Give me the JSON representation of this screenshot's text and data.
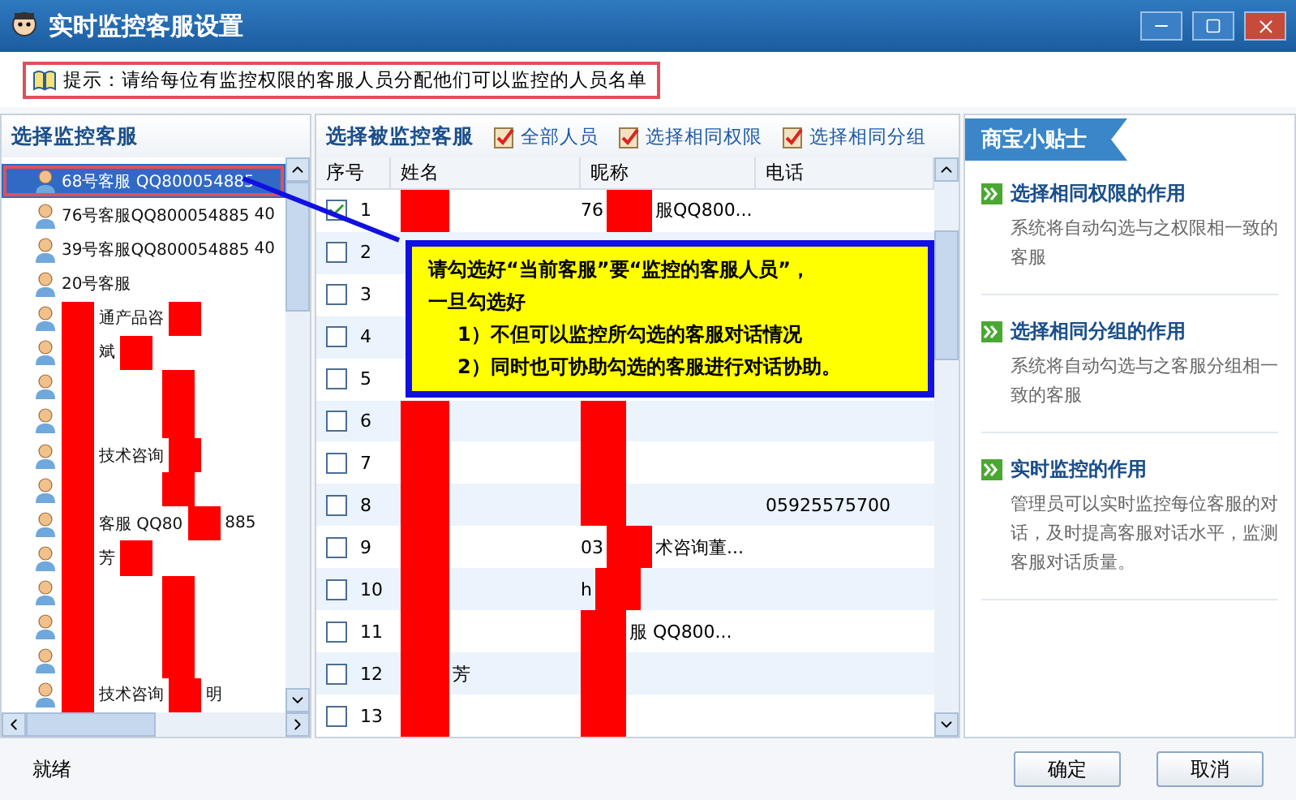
{
  "window": {
    "title": "实时监控客服设置"
  },
  "hint": "提示：请给每位有监控权限的客服人员分配他们可以监控的人员名单",
  "left_panel": {
    "title": "选择监控客服",
    "items": [
      {
        "selected": true,
        "segments": [
          {
            "kind": "text",
            "text": "68号客服 QQ800054885"
          }
        ]
      },
      {
        "selected": false,
        "segments": [
          {
            "kind": "text",
            "text": "76号客服QQ800054885"
          },
          {
            "kind": "text",
            "text": "40"
          }
        ]
      },
      {
        "selected": false,
        "segments": [
          {
            "kind": "text",
            "text": "39号客服QQ800054885"
          },
          {
            "kind": "text",
            "text": "40"
          }
        ]
      },
      {
        "selected": false,
        "segments": [
          {
            "kind": "text",
            "text": "20号客服"
          }
        ]
      },
      {
        "selected": false,
        "segments": [
          {
            "kind": "redaction"
          },
          {
            "kind": "text",
            "text": "通产品咨"
          },
          {
            "kind": "redaction"
          }
        ]
      },
      {
        "selected": false,
        "segments": [
          {
            "kind": "redaction"
          },
          {
            "kind": "text",
            "text": "斌"
          },
          {
            "kind": "redaction"
          }
        ]
      },
      {
        "selected": false,
        "segments": [
          {
            "kind": "redaction"
          },
          {
            "kind": "gap"
          },
          {
            "kind": "redaction"
          }
        ]
      },
      {
        "selected": false,
        "segments": [
          {
            "kind": "redaction"
          },
          {
            "kind": "gap"
          },
          {
            "kind": "redaction"
          }
        ]
      },
      {
        "selected": false,
        "segments": [
          {
            "kind": "redaction"
          },
          {
            "kind": "text",
            "text": "技术咨询"
          },
          {
            "kind": "redaction"
          }
        ]
      },
      {
        "selected": false,
        "segments": [
          {
            "kind": "redaction"
          },
          {
            "kind": "gap"
          },
          {
            "kind": "redaction"
          }
        ]
      },
      {
        "selected": false,
        "segments": [
          {
            "kind": "redaction"
          },
          {
            "kind": "text",
            "text": "客服 QQ80"
          },
          {
            "kind": "redaction"
          },
          {
            "kind": "text",
            "text": "885"
          }
        ]
      },
      {
        "selected": false,
        "segments": [
          {
            "kind": "redaction"
          },
          {
            "kind": "text",
            "text": "芳"
          },
          {
            "kind": "redaction"
          }
        ]
      },
      {
        "selected": false,
        "segments": [
          {
            "kind": "redaction"
          },
          {
            "kind": "gap"
          },
          {
            "kind": "redaction"
          }
        ]
      },
      {
        "selected": false,
        "segments": [
          {
            "kind": "redaction"
          },
          {
            "kind": "gap"
          },
          {
            "kind": "redaction"
          }
        ]
      },
      {
        "selected": false,
        "segments": [
          {
            "kind": "redaction"
          },
          {
            "kind": "gap"
          },
          {
            "kind": "redaction"
          }
        ]
      },
      {
        "selected": false,
        "segments": [
          {
            "kind": "redaction"
          },
          {
            "kind": "text",
            "text": "技术咨询"
          },
          {
            "kind": "redaction"
          },
          {
            "kind": "text",
            "text": "明"
          }
        ]
      }
    ]
  },
  "middle_panel": {
    "title": "选择被监控客服",
    "actions": [
      "全部人员",
      "选择相同权限",
      "选择相同分组"
    ],
    "columns": [
      "序号",
      "姓名",
      "昵称",
      "电话"
    ],
    "rows": [
      {
        "checked": true,
        "number": "1",
        "name": [
          {
            "kind": "redaction"
          }
        ],
        "nickname": [
          {
            "kind": "text",
            "text": "76"
          },
          {
            "kind": "redaction"
          },
          {
            "kind": "text",
            "text": "服QQ800..."
          }
        ],
        "phone": ""
      },
      {
        "checked": false,
        "number": "2",
        "name": [],
        "nickname": [],
        "phone": ""
      },
      {
        "checked": false,
        "number": "3",
        "name": [],
        "nickname": [],
        "phone": ""
      },
      {
        "checked": false,
        "number": "4",
        "name": [],
        "nickname": [],
        "phone": ""
      },
      {
        "checked": false,
        "number": "5",
        "name": [],
        "nickname": [],
        "phone": ""
      },
      {
        "checked": false,
        "number": "6",
        "name": [
          {
            "kind": "redaction"
          }
        ],
        "nickname": [
          {
            "kind": "redaction"
          }
        ],
        "phone": ""
      },
      {
        "checked": false,
        "number": "7",
        "name": [
          {
            "kind": "redaction"
          }
        ],
        "nickname": [
          {
            "kind": "redaction"
          }
        ],
        "phone": ""
      },
      {
        "checked": false,
        "number": "8",
        "name": [
          {
            "kind": "redaction"
          }
        ],
        "nickname": [
          {
            "kind": "redaction"
          }
        ],
        "phone": "05925575700"
      },
      {
        "checked": false,
        "number": "9",
        "name": [
          {
            "kind": "redaction"
          }
        ],
        "nickname": [
          {
            "kind": "text",
            "text": "03"
          },
          {
            "kind": "redaction"
          },
          {
            "kind": "text",
            "text": "术咨询董..."
          }
        ],
        "phone": ""
      },
      {
        "checked": false,
        "number": "10",
        "name": [
          {
            "kind": "redaction"
          }
        ],
        "nickname": [
          {
            "kind": "text",
            "text": "h"
          },
          {
            "kind": "redaction"
          }
        ],
        "phone": ""
      },
      {
        "checked": false,
        "number": "11",
        "name": [
          {
            "kind": "redaction"
          }
        ],
        "nickname": [
          {
            "kind": "redaction"
          },
          {
            "kind": "text",
            "text": "服 QQ800..."
          }
        ],
        "phone": ""
      },
      {
        "checked": false,
        "number": "12",
        "name": [
          {
            "kind": "redaction"
          },
          {
            "kind": "text",
            "text": "芳"
          }
        ],
        "nickname": [
          {
            "kind": "redaction"
          }
        ],
        "phone": ""
      },
      {
        "checked": false,
        "number": "13",
        "name": [
          {
            "kind": "redaction"
          }
        ],
        "nickname": [
          {
            "kind": "redaction"
          }
        ],
        "phone": ""
      }
    ]
  },
  "callout": {
    "lines": [
      "请勾选好“当前客服”要“监控的客服人员”，",
      "一旦勾选好",
      "1）不但可以监控所勾选的客服对话情况",
      "2）同时也可协助勾选的客服进行对话协助。"
    ]
  },
  "tips": {
    "title": "商宝小贴士",
    "items": [
      {
        "title": "选择相同权限的作用",
        "text": "系统将自动勾选与之权限相一致的客服"
      },
      {
        "title": "选择相同分组的作用",
        "text": "系统将自动勾选与之客服分组相一致的客服"
      },
      {
        "title": "实时监控的作用",
        "text": "管理员可以实时监控每位客服的对话，及时提高客服对话水平，监测客服对话质量。"
      }
    ]
  },
  "status_bar": {
    "text": "就绪",
    "buttons": [
      "确定",
      "取消"
    ]
  }
}
